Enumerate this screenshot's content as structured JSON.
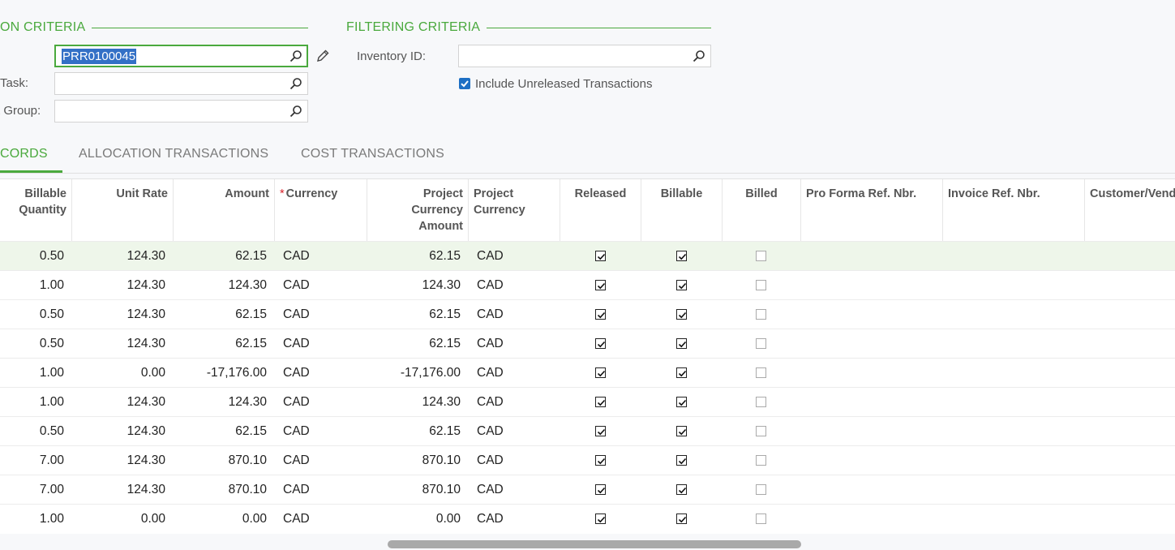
{
  "selection_criteria": {
    "title": "ON CRITERIA",
    "ref_nbr_value": "PRR0100045",
    "task_label": "Task:",
    "task_value": "",
    "group_label": "t Group:",
    "group_value": ""
  },
  "filtering_criteria": {
    "title": "FILTERING CRITERIA",
    "inventory_label": "Inventory ID:",
    "inventory_value": "",
    "include_unreleased_label": "Include Unreleased Transactions",
    "include_unreleased_checked": true
  },
  "tabs": [
    {
      "label": "CORDS",
      "active": true
    },
    {
      "label": "ALLOCATION TRANSACTIONS",
      "active": false
    },
    {
      "label": "COST TRANSACTIONS",
      "active": false
    }
  ],
  "columns": {
    "billable_qty": "Billable Quantity",
    "unit_rate": "Unit Rate",
    "amount": "Amount",
    "currency": "Currency",
    "proj_cur_amount": "Project Currency Amount",
    "proj_currency": "Project Currency",
    "released": "Released",
    "billable": "Billable",
    "billed": "Billed",
    "pro_forma": "Pro Forma Ref. Nbr.",
    "invoice": "Invoice Ref. Nbr.",
    "customer": "Customer/Vend"
  },
  "rows": [
    {
      "qty": "0.50",
      "rate": "124.30",
      "amount": "62.15",
      "cur": "CAD",
      "pamount": "62.15",
      "pcur": "CAD",
      "released": true,
      "billable": true,
      "billed": false
    },
    {
      "qty": "1.00",
      "rate": "124.30",
      "amount": "124.30",
      "cur": "CAD",
      "pamount": "124.30",
      "pcur": "CAD",
      "released": true,
      "billable": true,
      "billed": false
    },
    {
      "qty": "0.50",
      "rate": "124.30",
      "amount": "62.15",
      "cur": "CAD",
      "pamount": "62.15",
      "pcur": "CAD",
      "released": true,
      "billable": true,
      "billed": false
    },
    {
      "qty": "0.50",
      "rate": "124.30",
      "amount": "62.15",
      "cur": "CAD",
      "pamount": "62.15",
      "pcur": "CAD",
      "released": true,
      "billable": true,
      "billed": false
    },
    {
      "qty": "1.00",
      "rate": "0.00",
      "amount": "-17,176.00",
      "cur": "CAD",
      "pamount": "-17,176.00",
      "pcur": "CAD",
      "released": true,
      "billable": true,
      "billed": false
    },
    {
      "qty": "1.00",
      "rate": "124.30",
      "amount": "124.30",
      "cur": "CAD",
      "pamount": "124.30",
      "pcur": "CAD",
      "released": true,
      "billable": true,
      "billed": false
    },
    {
      "qty": "0.50",
      "rate": "124.30",
      "amount": "62.15",
      "cur": "CAD",
      "pamount": "62.15",
      "pcur": "CAD",
      "released": true,
      "billable": true,
      "billed": false
    },
    {
      "qty": "7.00",
      "rate": "124.30",
      "amount": "870.10",
      "cur": "CAD",
      "pamount": "870.10",
      "pcur": "CAD",
      "released": true,
      "billable": true,
      "billed": false
    },
    {
      "qty": "7.00",
      "rate": "124.30",
      "amount": "870.10",
      "cur": "CAD",
      "pamount": "870.10",
      "pcur": "CAD",
      "released": true,
      "billable": true,
      "billed": false
    },
    {
      "qty": "1.00",
      "rate": "0.00",
      "amount": "0.00",
      "cur": "CAD",
      "pamount": "0.00",
      "pcur": "CAD",
      "released": true,
      "billable": true,
      "billed": false
    }
  ],
  "colors": {
    "accent": "#4aa93d",
    "selection": "#3370c6",
    "checkbox": "#1d6fc4"
  },
  "icons": [
    "search-icon",
    "pencil-icon",
    "checkbox-icon"
  ]
}
